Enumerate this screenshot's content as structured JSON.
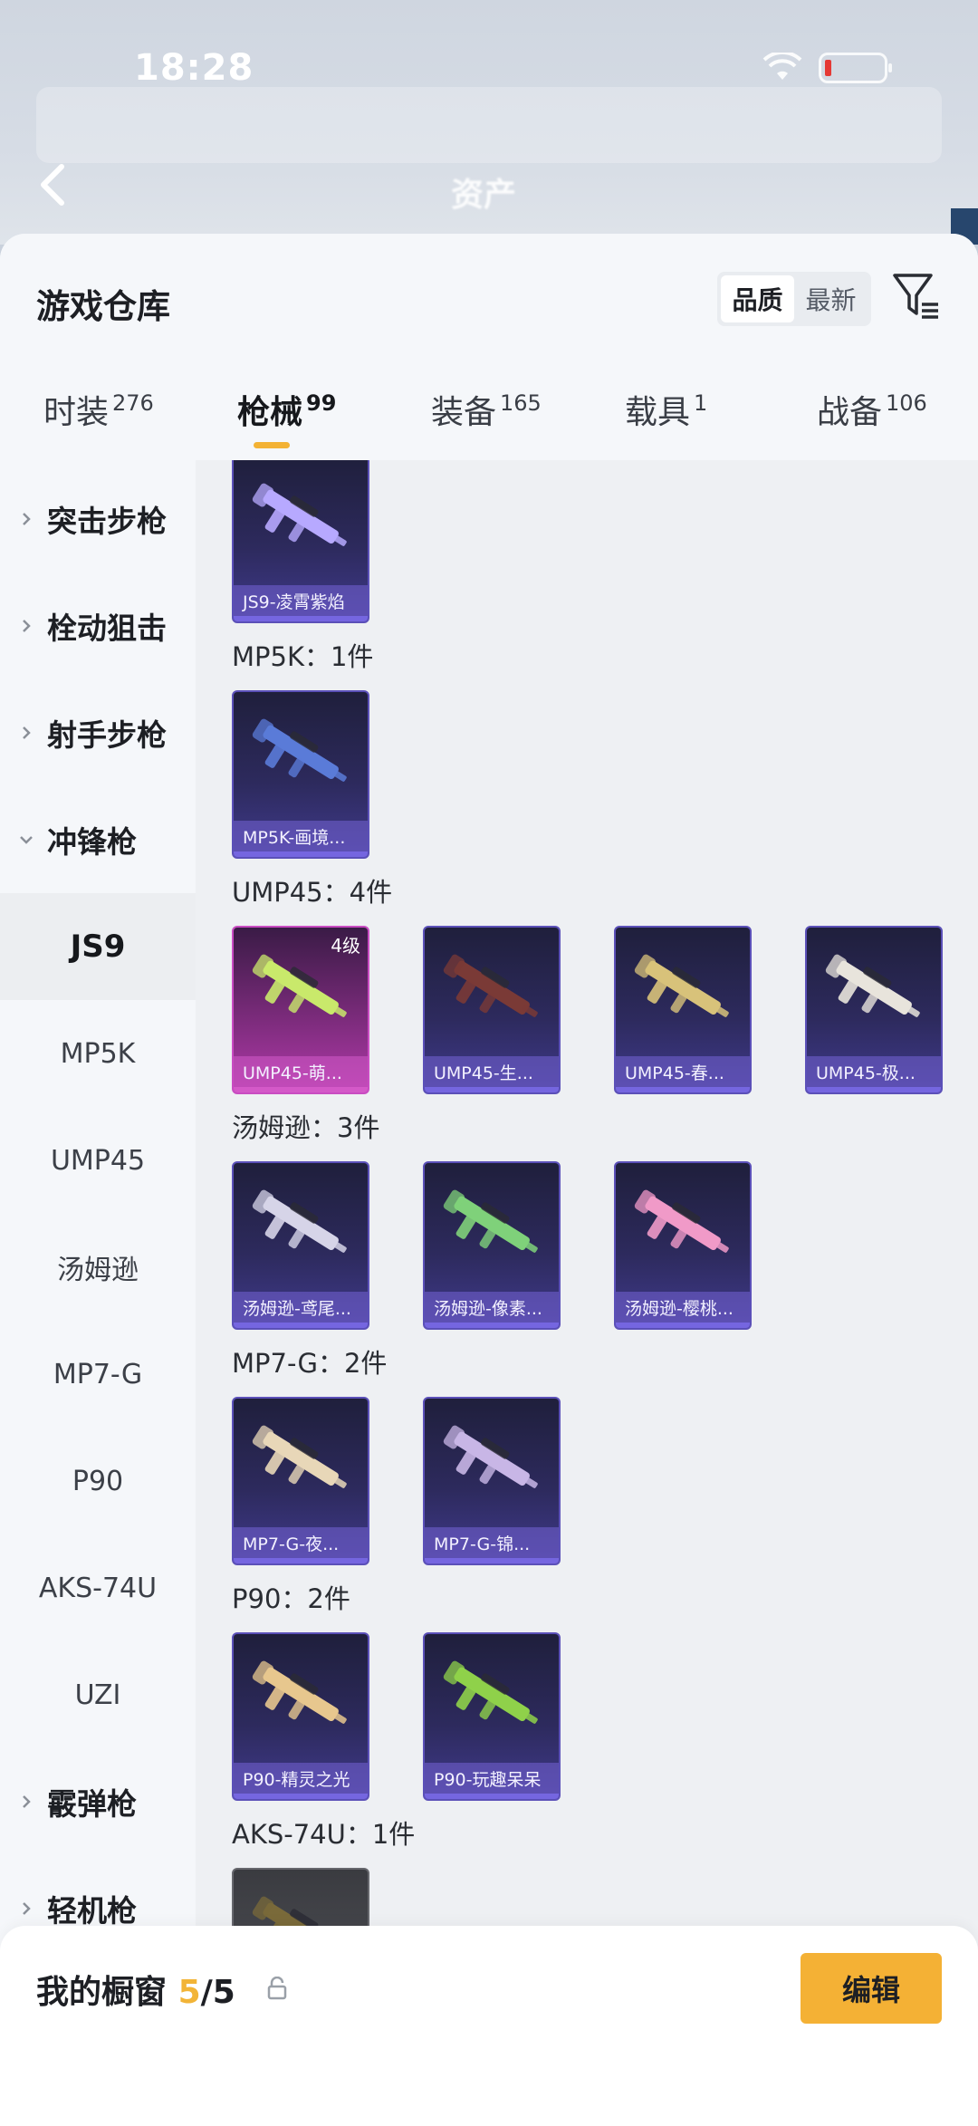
{
  "status_bar": {
    "time": "18:28"
  },
  "background": {
    "title": "资产"
  },
  "header": {
    "title": "游戏仓库",
    "sort_options": [
      "品质",
      "最新"
    ],
    "active_sort": "品质"
  },
  "tabs": [
    {
      "label": "时装",
      "count": "276"
    },
    {
      "label": "枪械",
      "count": "99"
    },
    {
      "label": "装备",
      "count": "165"
    },
    {
      "label": "载具",
      "count": "1"
    },
    {
      "label": "战备",
      "count": "106"
    }
  ],
  "sidebar": {
    "items": [
      {
        "label": "突击步枪",
        "type": "group"
      },
      {
        "label": "栓动狙击",
        "type": "group"
      },
      {
        "label": "射手步枪",
        "type": "group"
      },
      {
        "label": "冲锋枪",
        "type": "group-open"
      },
      {
        "label": "JS9",
        "type": "sub-active"
      },
      {
        "label": "MP5K",
        "type": "sub"
      },
      {
        "label": "UMP45",
        "type": "sub"
      },
      {
        "label": "汤姆逊",
        "type": "sub"
      },
      {
        "label": "MP7-G",
        "type": "sub"
      },
      {
        "label": "P90",
        "type": "sub"
      },
      {
        "label": "AKS-74U",
        "type": "sub"
      },
      {
        "label": "UZI",
        "type": "sub"
      },
      {
        "label": "霰弹枪",
        "type": "group"
      },
      {
        "label": "轻机枪",
        "type": "group"
      }
    ]
  },
  "sections": [
    {
      "label": "",
      "items": [
        {
          "name": "JS9-凌霄紫焰",
          "color": "#b7a9ff",
          "rarity": "purple"
        }
      ]
    },
    {
      "label": "MP5K：1件",
      "items": [
        {
          "name": "MP5K-画境...",
          "color": "#5a7bd8",
          "rarity": "purple"
        }
      ]
    },
    {
      "label": "UMP45：4件",
      "items": [
        {
          "name": "UMP45-萌...",
          "color": "#c9e96b",
          "rarity": "pink",
          "level": "4级"
        },
        {
          "name": "UMP45-生...",
          "color": "#7a3a36",
          "rarity": "purple"
        },
        {
          "name": "UMP45-春...",
          "color": "#d8c27a",
          "rarity": "purple"
        },
        {
          "name": "UMP45-极...",
          "color": "#e8e4dc",
          "rarity": "purple"
        }
      ]
    },
    {
      "label": "汤姆逊：3件",
      "items": [
        {
          "name": "汤姆逊-鸢尾...",
          "color": "#d6d4e8",
          "rarity": "purple"
        },
        {
          "name": "汤姆逊-像素...",
          "color": "#7fd17a",
          "rarity": "purple"
        },
        {
          "name": "汤姆逊-樱桃...",
          "color": "#f09ac8",
          "rarity": "purple"
        }
      ]
    },
    {
      "label": "MP7-G：2件",
      "items": [
        {
          "name": "MP7-G-夜...",
          "color": "#e8d7b8",
          "rarity": "purple"
        },
        {
          "name": "MP7-G-锦...",
          "color": "#c8b6e6",
          "rarity": "purple"
        }
      ]
    },
    {
      "label": "P90：2件",
      "items": [
        {
          "name": "P90-精灵之光",
          "color": "#e7c78e",
          "rarity": "purple"
        },
        {
          "name": "P90-玩趣呆呆",
          "color": "#8fd14a",
          "rarity": "purple"
        }
      ]
    },
    {
      "label": "AKS-74U：1件",
      "items": [
        {
          "name": "",
          "color": "#7a6a3a",
          "rarity": "grey"
        }
      ]
    }
  ],
  "bottom_bar": {
    "label": "我的橱窗",
    "count": "5",
    "total": "/5",
    "edit_label": "编辑"
  }
}
